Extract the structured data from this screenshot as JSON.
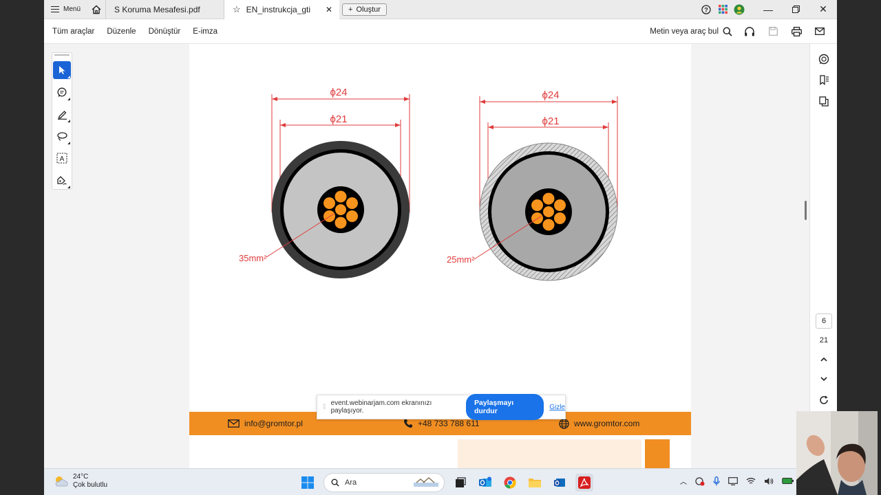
{
  "tabs": {
    "menu_label": "Menü",
    "tab1": "S Koruma Mesafesi.pdf",
    "tab2": "EN_instrukcja_gti",
    "new_tab": "Oluştur"
  },
  "toolbar": {
    "items": [
      "Tüm araçlar",
      "Düzenle",
      "Dönüştür",
      "E-imza"
    ],
    "search_text": "Metin veya araç bul"
  },
  "drawing": {
    "left_outer": "ϕ24",
    "left_inner": "ϕ21",
    "left_area": "35mm²",
    "right_outer": "ϕ24",
    "right_inner": "ϕ21",
    "right_area": "25mm²"
  },
  "footer": {
    "email": "info@gromtor.pl",
    "phone": "+48 733 788 611",
    "website": "www.gromtor.com",
    "color": "#f18e22"
  },
  "share_bar": {
    "message": "event.webinarjam.com ekranınızı paylaşıyor.",
    "stop_button": "Paylaşmayı durdur",
    "hide_link": "Gizle"
  },
  "pagination": {
    "current_page": "6",
    "total_pages": "21"
  },
  "taskbar": {
    "temperature": "24°C",
    "weather": "Çok bulutlu",
    "search_placeholder": "Ara"
  },
  "colors": {
    "accent": "#1a64d6",
    "dimension_red": "#e03b3b",
    "conductor_orange": "#f7941d"
  }
}
